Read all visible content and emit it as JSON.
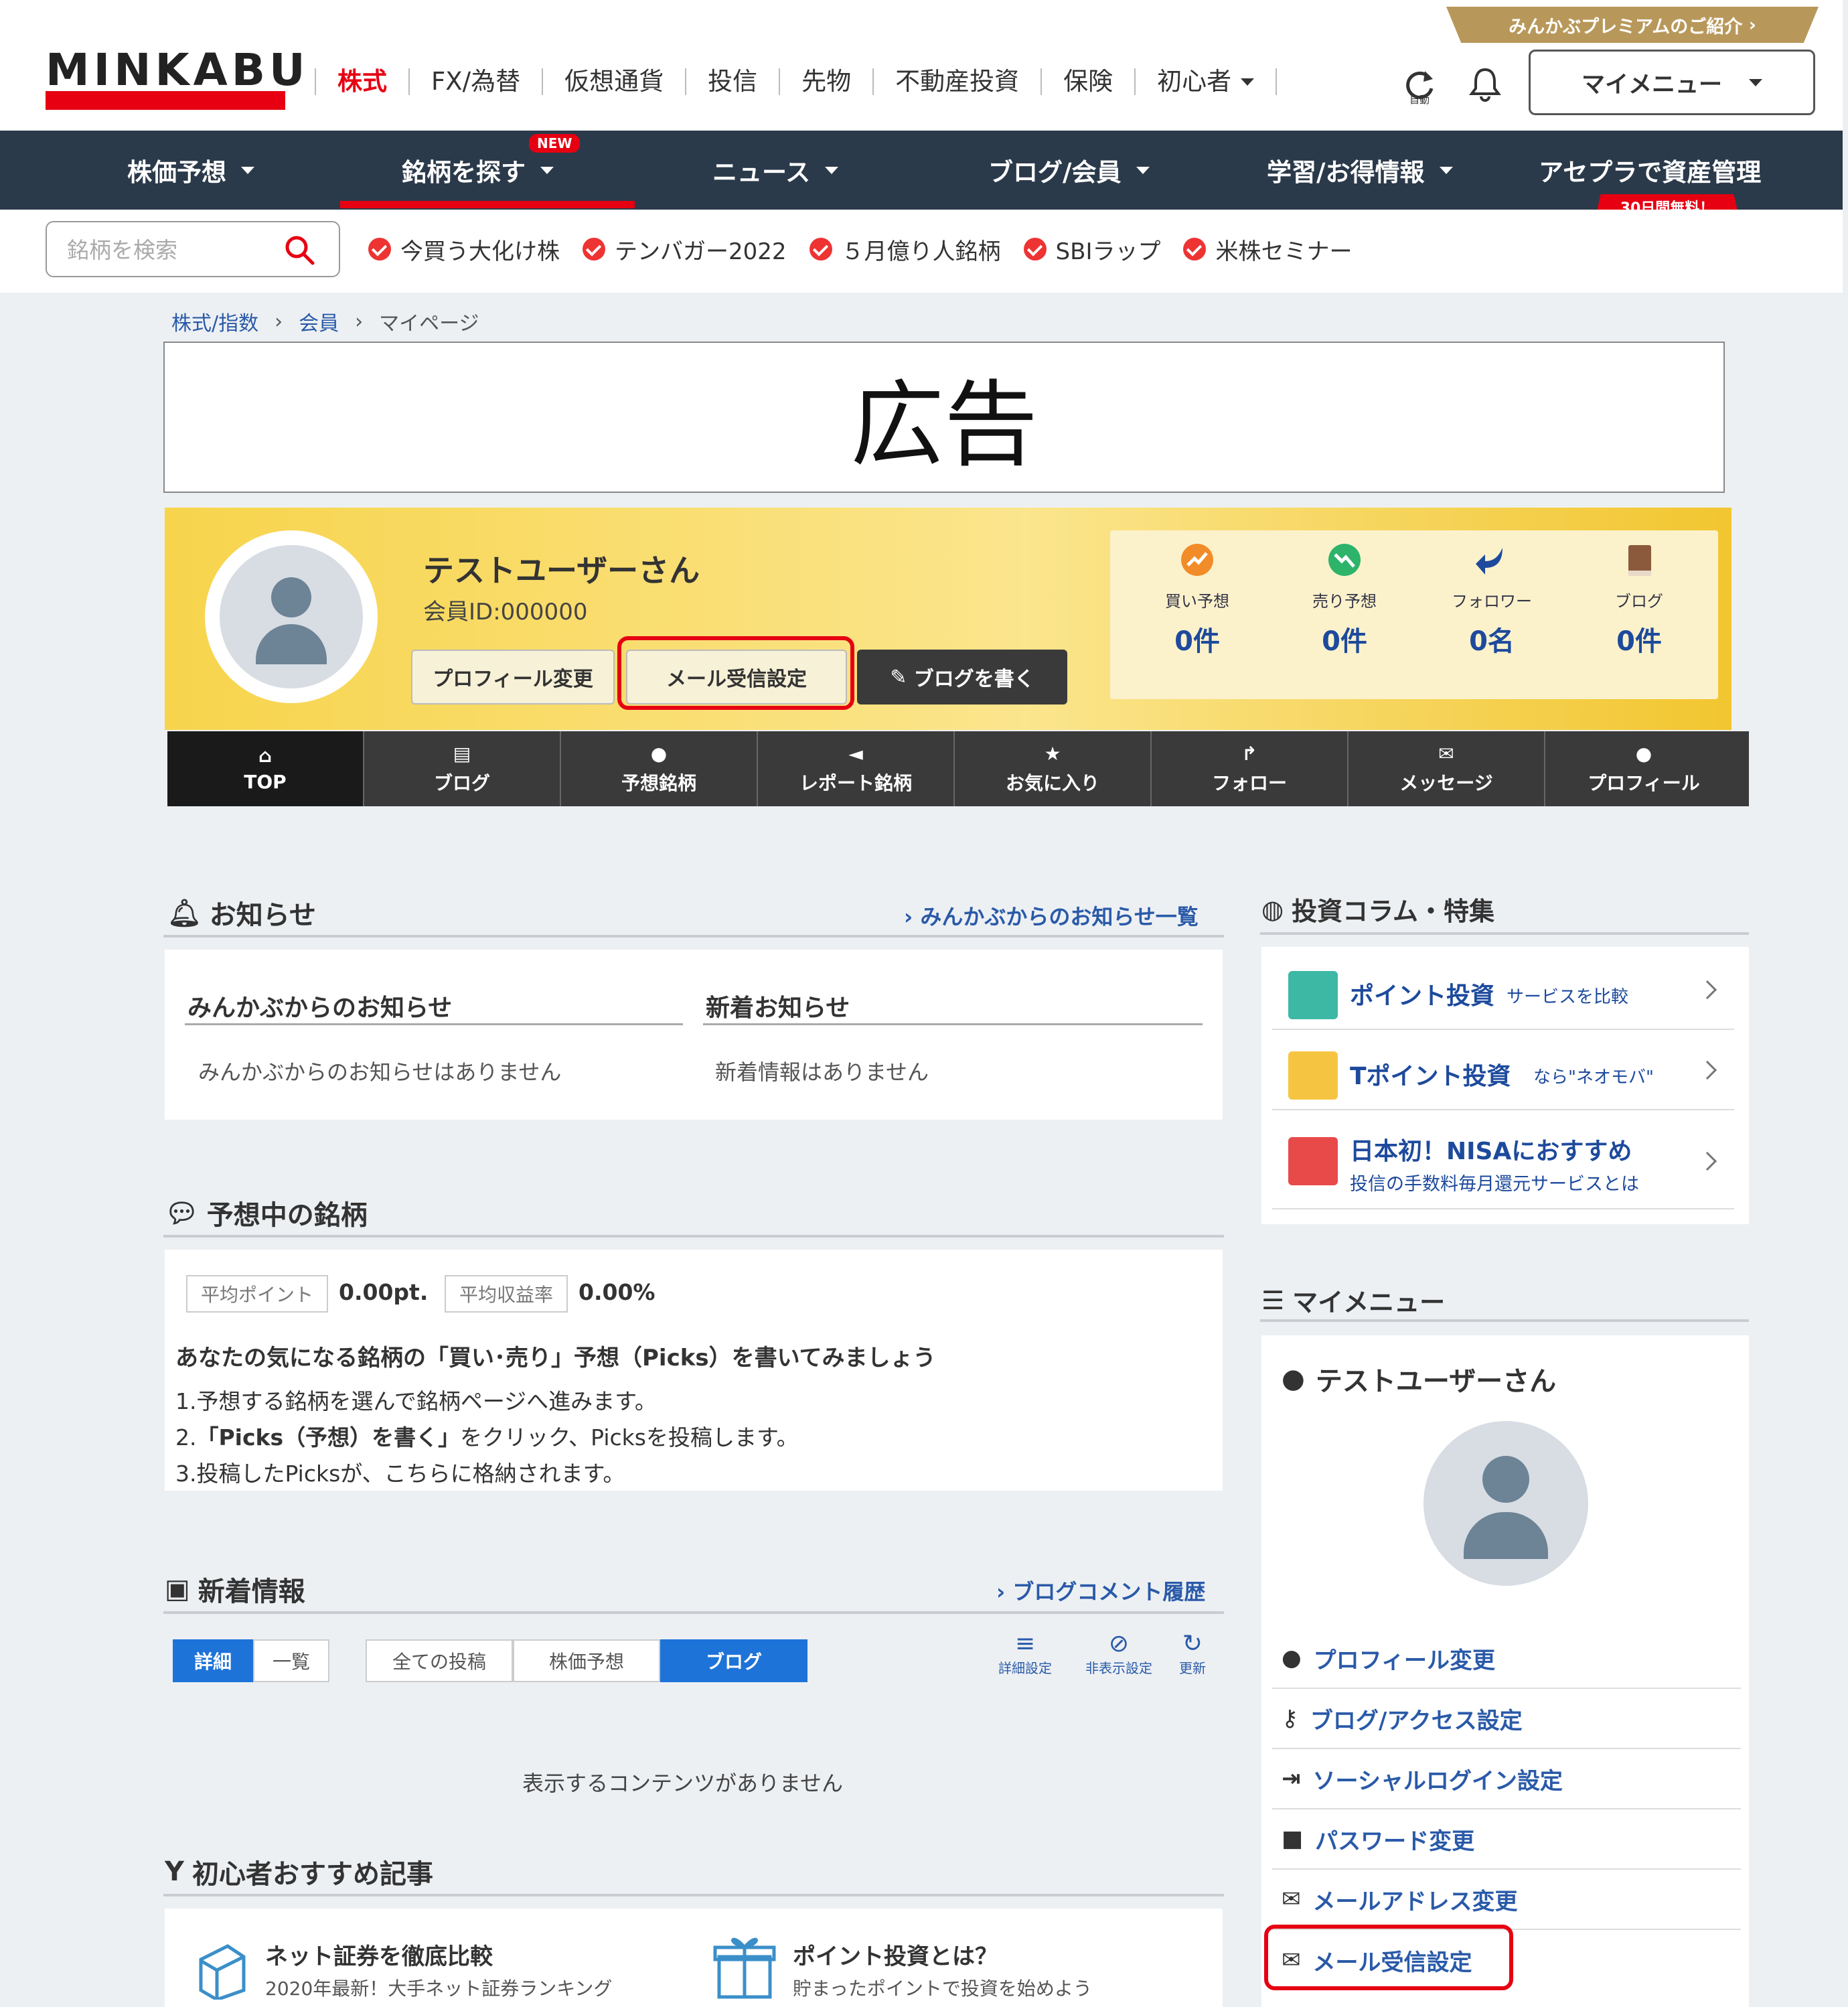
{
  "header": {
    "logo": "MINKABU",
    "premium": "みんかぶプレミアムのご紹介",
    "nav": [
      "株式",
      "FX/為替",
      "仮想通貨",
      "投信",
      "先物",
      "不動産投資",
      "保険",
      "初心者"
    ],
    "mymenu": "マイメニュー",
    "refresh_label": "自動"
  },
  "darknav": {
    "items": [
      "株価予想",
      "銘柄を探す",
      "ニュース",
      "ブログ/会員",
      "学習/お得情報",
      "アセプラで資産管理"
    ],
    "new_badge": "NEW",
    "free_badge": "30日間無料！"
  },
  "search": {
    "placeholder": "銘柄を検索"
  },
  "quick_links": [
    "今買う大化け株",
    "テンバガー2022",
    "５月億り人銘柄",
    "SBIラップ",
    "米株セミナー"
  ],
  "breadcrumb": [
    "株式/指数",
    "会員",
    "マイページ"
  ],
  "ad": "広告",
  "profile": {
    "name": "テストユーザーさん",
    "member_id": "会員ID:000000",
    "btn_profile": "プロフィール変更",
    "btn_mail": "メール受信設定",
    "btn_blog": "ブログを書く",
    "stats": [
      {
        "label": "買い予想",
        "value": "0件"
      },
      {
        "label": "売り予想",
        "value": "0件"
      },
      {
        "label": "フォロワー",
        "value": "0名"
      },
      {
        "label": "ブログ",
        "value": "0件"
      }
    ]
  },
  "tabs": [
    "TOP",
    "ブログ",
    "予想銘柄",
    "レポート銘柄",
    "お気に入り",
    "フォロー",
    "メッセージ",
    "プロフィール"
  ],
  "notice": {
    "title": "お知らせ",
    "link": "みんかぶからのお知らせ一覧",
    "col1_title": "みんかぶからのお知らせ",
    "col1_text": "みんかぶからのお知らせはありません",
    "col2_title": "新着お知らせ",
    "col2_text": "新着情報はありません"
  },
  "forecast": {
    "title": "予想中の銘柄",
    "avg_point_label": "平均ポイント",
    "avg_point": "0.00pt.",
    "avg_return_label": "平均収益率",
    "avg_return": "0.00%",
    "heading": "あなたの気になる銘柄の「買い･売り」予想（Picks）を書いてみましょう",
    "step1": "1.予想する銘柄を選んで銘柄ページへ進みます。",
    "step2_prefix": "2.",
    "step2_bold": "「Picks（予想）を書く」",
    "step2_suffix": "をクリック、Picksを投稿します。",
    "step3": "3.投稿したPicksが、こちらに格納されます。"
  },
  "news": {
    "title": "新着情報",
    "link": "ブログコメント履歴",
    "view_buttons": [
      "詳細",
      "一覧"
    ],
    "filters": [
      "全ての投稿",
      "株価予想",
      "ブログ"
    ],
    "tools": [
      "詳細設定",
      "非表示設定",
      "更新"
    ],
    "empty": "表示するコンテンツがありません"
  },
  "beginner": {
    "title": "初心者おすすめ記事",
    "items": [
      {
        "title": "ネット証券を徹底比較",
        "sub": "2020年最新！大手ネット証券ランキング"
      },
      {
        "title": "ポイント投資とは？",
        "sub": "貯まったポイントで投資を始めよう"
      }
    ]
  },
  "column": {
    "title": "投資コラム・特集",
    "items": [
      {
        "title": "ポイント投資",
        "sub": "サービスを比較",
        "color": "#3cb8a4"
      },
      {
        "title": "Tポイント投資",
        "sub": "なら\"ネオモバ\"",
        "color": "#f5c542"
      },
      {
        "title": "日本初！NISAにおすすめ",
        "sub": "投信の手数料毎月還元サービスとは",
        "color": "#e84a4a"
      }
    ]
  },
  "side_menu": {
    "title": "マイメニュー",
    "user": "テストユーザーさん",
    "items": [
      "プロフィール変更",
      "ブログ/アクセス設定",
      "ソーシャルログイン設定",
      "パスワード変更",
      "メールアドレス変更",
      "メール受信設定"
    ]
  },
  "colors": {
    "brand_red": "#e60012",
    "nav_dark": "#2b3a4a",
    "link_blue": "#2a5aa8",
    "accent_blue": "#1e73d8"
  }
}
